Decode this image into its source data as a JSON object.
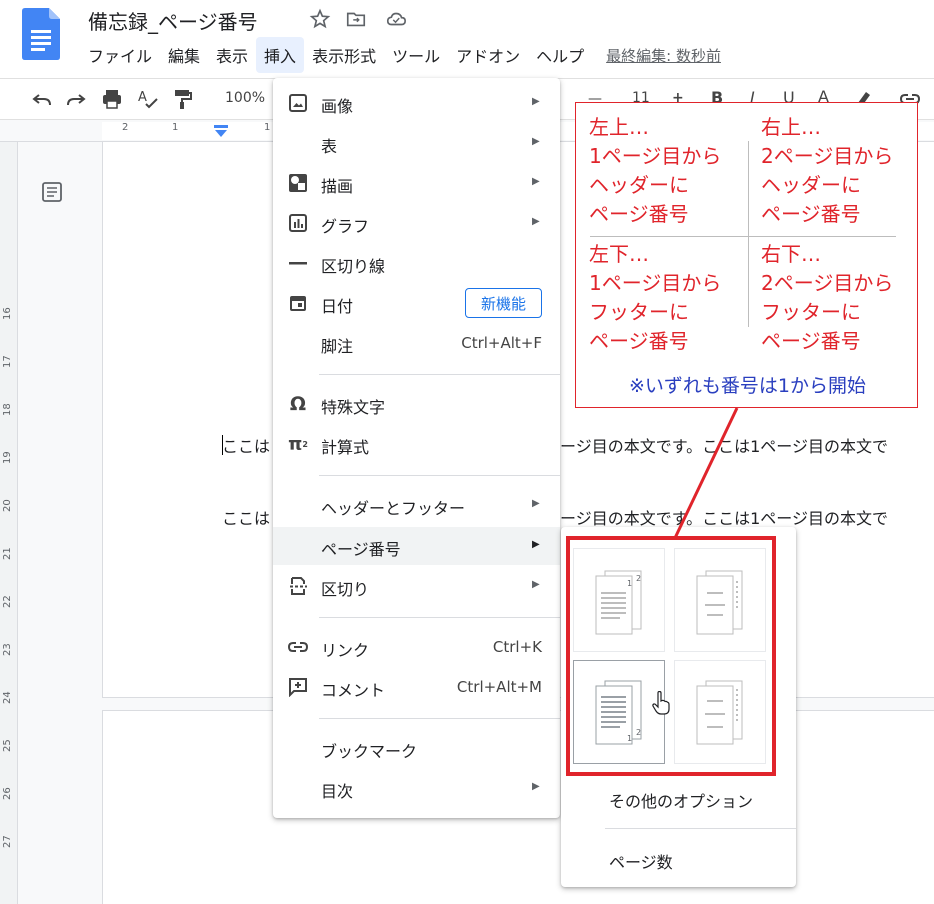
{
  "doc": {
    "title": "備忘録_ページ番号"
  },
  "menubar": {
    "items": [
      "ファイル",
      "編集",
      "表示",
      "挿入",
      "表示形式",
      "ツール",
      "アドオン",
      "ヘルプ"
    ],
    "last_edit": "最終編集: 数秒前"
  },
  "toolbar": {
    "zoom": "100%",
    "font_size": "11",
    "bold": "B",
    "italic": "I",
    "underline": "U",
    "text_color": "A"
  },
  "ruler": {
    "ticks": [
      "2",
      "1",
      "1"
    ],
    "vticks": [
      "16",
      "17",
      "18",
      "19",
      "20",
      "21",
      "22",
      "23",
      "24",
      "25",
      "26",
      "27"
    ]
  },
  "document": {
    "line1_left": "ここは",
    "line1_right": "ージ目の本文です。ここは1ページ目の本文で",
    "line2_left": "ここは",
    "line2_right": "ージ目の本文です。ここは1ページ目の本文で"
  },
  "insert_menu": {
    "items": [
      {
        "label": "画像",
        "icon": "image-icon",
        "submenu": true
      },
      {
        "label": "表",
        "icon": "",
        "submenu": true
      },
      {
        "label": "描画",
        "icon": "drawing-icon",
        "submenu": true
      },
      {
        "label": "グラフ",
        "icon": "chart-icon",
        "submenu": true
      },
      {
        "label": "区切り線",
        "icon": "horizontal-line-icon",
        "submenu": false
      },
      {
        "label": "日付",
        "icon": "calendar-icon",
        "badge": "新機能"
      },
      {
        "label": "脚注",
        "icon": "",
        "shortcut": "Ctrl+Alt+F"
      },
      {
        "label": "特殊文字",
        "icon": "omega-icon"
      },
      {
        "label": "計算式",
        "icon": "pi-icon"
      },
      {
        "label": "ヘッダーとフッター",
        "icon": "",
        "submenu": true
      },
      {
        "label": "ページ番号",
        "icon": "",
        "submenu": true
      },
      {
        "label": "区切り",
        "icon": "page-break-icon",
        "submenu": true
      },
      {
        "label": "リンク",
        "icon": "link-icon",
        "shortcut": "Ctrl+K"
      },
      {
        "label": "コメント",
        "icon": "add-comment-icon",
        "shortcut": "Ctrl+Alt+M"
      },
      {
        "label": "ブックマーク",
        "icon": ""
      },
      {
        "label": "目次",
        "icon": "",
        "submenu": true
      }
    ]
  },
  "page_number_menu": {
    "more_options": "その他のオプション",
    "page_count": "ページ数"
  },
  "annotation": {
    "top_left": "左上…\n1ページ目から\nヘッダーに\nページ番号",
    "top_right": "右上…\n2ページ目から\nヘッダーに\nページ番号",
    "bottom_left": "左下…\n1ページ目から\nフッターに\nページ番号",
    "bottom_right": "右下…\n2ページ目から\nフッターに\nページ番号",
    "note": "※いずれも番号は1から開始",
    "color": "#e0242b",
    "note_color": "#2a3fbf"
  }
}
